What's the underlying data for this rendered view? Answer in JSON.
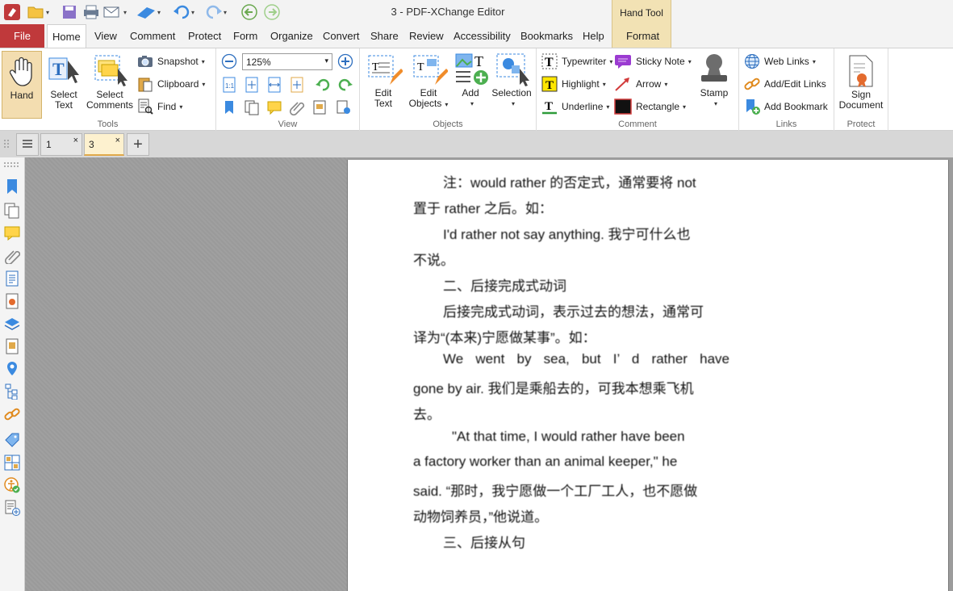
{
  "title_bar": {
    "title": "3 - PDF-XChange Editor",
    "context_group": "Hand Tool"
  },
  "menu": {
    "file": "File",
    "tabs": [
      "Home",
      "View",
      "Comment",
      "Protect",
      "Form",
      "Organize",
      "Convert",
      "Share",
      "Review",
      "Accessibility",
      "Bookmarks",
      "Help"
    ],
    "context_tab": "Format"
  },
  "ribbon": {
    "tools": {
      "label": "Tools",
      "hand": "Hand",
      "select_text": [
        "Select",
        "Text"
      ],
      "select_comments": [
        "Select",
        "Comments"
      ],
      "snapshot": "Snapshot",
      "clipboard": "Clipboard",
      "find": "Find"
    },
    "view": {
      "label": "View",
      "zoom": "125%"
    },
    "objects": {
      "label": "Objects",
      "edit_text": [
        "Edit",
        "Text"
      ],
      "edit_objects": [
        "Edit",
        "Objects"
      ],
      "add": "Add",
      "selection": "Selection"
    },
    "comment": {
      "label": "Comment",
      "typewriter": "Typewriter",
      "sticky_note": "Sticky Note",
      "highlight": "Highlight",
      "arrow": "Arrow",
      "underline": "Underline",
      "rectangle": "Rectangle",
      "stamp": "Stamp"
    },
    "links": {
      "label": "Links",
      "web_links": "Web Links",
      "add_edit_links": "Add/Edit Links",
      "add_bookmark": "Add Bookmark"
    },
    "protect": {
      "label": "Protect",
      "sign_document": [
        "Sign",
        "Document"
      ]
    }
  },
  "doc_tabs": [
    {
      "label": "1",
      "close": "×"
    },
    {
      "label": "3",
      "close": "×"
    }
  ],
  "new_tab": "+",
  "document": {
    "lines": [
      "注：would rather 的否定式，通常要将 not",
      "置于 rather 之后。如：",
      "I'd rather not say anything. 我宁可什么也",
      "不说。",
      "二、后接完成式动词",
      "后接完成式动词，表示过去的想法，通常可",
      "译为“(本来)宁愿做某事”。如：",
      "We went by sea, but I’ d rather have",
      "gone by air. 我们是乘船去的，可我本想乘飞机",
      "去。",
      "\"At that time, I would rather have been",
      "a factory worker than an animal keeper,\"   he",
      "said. “那时，我宁愿做一个工厂工人，也不愿做",
      "动物饲养员，”他说道。",
      "三、后接从句"
    ]
  },
  "colors": {
    "file_tab": "#c0393b",
    "context_tab": "#f2e2b4",
    "hand_active": "#f3ddb0",
    "accent_blue": "#2e7bd6",
    "highlight_yellow": "#ffe600",
    "sticky_purple": "#9b3bd1"
  }
}
